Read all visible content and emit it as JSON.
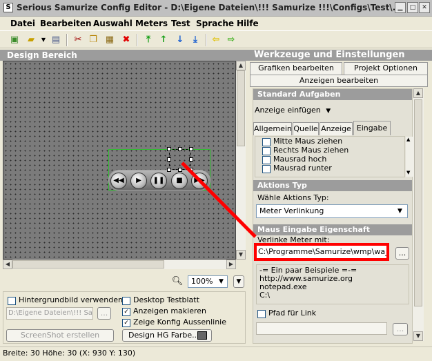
{
  "window": {
    "title": "Serious Samurize Config Editor - D:\\Eigene Dateien\\!!! Samurize !!!\\Configs\\Test\\..."
  },
  "menu": [
    "Datei",
    "Bearbeiten",
    "Auswahl",
    "Meters",
    "Test",
    "Sprache",
    "Hilfe"
  ],
  "left_panel": {
    "header": "Design Bereich",
    "zoom": "100%"
  },
  "bottom_left": {
    "hintergrund_label": "Hintergrundbild verwenden",
    "path_value": "D:\\Eigene Dateien\\!!! Sa",
    "browse": "...",
    "screenshot_button": "ScreenShot erstellen",
    "desktop_label": "Desktop Testblatt",
    "anzeigen_label": "Anzeigen makieren",
    "konfig_label": "Zeige Konfig Aussenlinie",
    "design_hg_button": "Design HG Farbe..."
  },
  "right_panel": {
    "header": "Werkzeuge und Einstellungen",
    "tab_grafiken": "Grafiken bearbeiten",
    "tab_projekt": "Projekt Optionen",
    "tab_anzeigen": "Anzeigen bearbeiten",
    "standard_header": "Standard Aufgaben",
    "anzeige_einfuegen": "Anzeige einfügen",
    "sub_tabs": [
      "Allgemein",
      "Quelle",
      "Anzeige",
      "Eingabe"
    ],
    "events": [
      "Mitte Maus ziehen",
      "Rechts Maus ziehen",
      "Mausrad hoch",
      "Mausrad runter"
    ],
    "aktions_header": "Aktions Typ",
    "waehle_label": "Wähle Aktions Typ:",
    "aktions_value": "Meter Verlinkung",
    "maus_header": "Maus Eingabe Eigenschaft",
    "verlinke_label": "Verlinke Meter mit:",
    "path_value": "C:\\Programme\\Samurize\\wmp\\wa_stop",
    "browse": "...",
    "examples": [
      "-= Ein paar Beispiele =-=",
      "http://www.samurize.org",
      "notepad.exe",
      "C:\\"
    ],
    "pfad_label": "Pfad für Link",
    "browse2": "..."
  },
  "status": {
    "text": "Breite: 30  Höhe: 30  (X: 930  Y: 130)"
  },
  "colors": {
    "highlight": "#ff0000",
    "header_bg": "#9c9c9c"
  }
}
